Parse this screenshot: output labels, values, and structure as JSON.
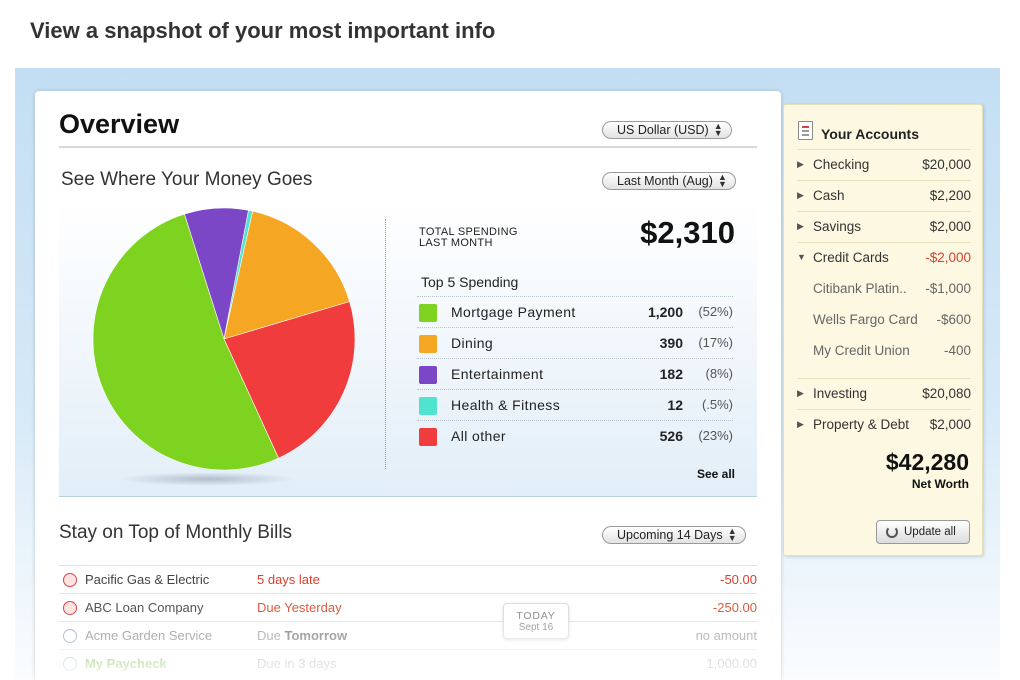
{
  "headline": "View a snapshot of your most important info",
  "overview": {
    "title": "Overview",
    "currency_select": "US Dollar (USD)"
  },
  "spending": {
    "title": "See Where Your Money Goes",
    "period_select": "Last Month (Aug)",
    "total_label_line1": "TOTAL SPENDING",
    "total_label_line2": "LAST MONTH",
    "total_amount": "$2,310",
    "top_title": "Top 5 Spending",
    "items": [
      {
        "label": "Mortgage Payment",
        "value": "1,200",
        "pct": "(52%)",
        "color": "#7ed321"
      },
      {
        "label": "Dining",
        "value": "390",
        "pct": "(17%)",
        "color": "#f5a623"
      },
      {
        "label": "Entertainment",
        "value": "182",
        "pct": "(8%)",
        "color": "#7b47c7"
      },
      {
        "label": "Health & Fitness",
        "value": "12",
        "pct": "(.5%)",
        "color": "#4fe3d0"
      },
      {
        "label": "All other",
        "value": "526",
        "pct": "(23%)",
        "color": "#f03c3c"
      }
    ],
    "see_all": "See all"
  },
  "chart_data": {
    "type": "pie",
    "categories": [
      "Mortgage Payment",
      "Dining",
      "Entertainment",
      "Health & Fitness",
      "All other"
    ],
    "values": [
      1200,
      390,
      182,
      12,
      526
    ],
    "colors": [
      "#7ed321",
      "#f5a623",
      "#7b47c7",
      "#4fe3d0",
      "#f03c3c"
    ]
  },
  "bills": {
    "title": "Stay on Top of Monthly Bills",
    "range_select": "Upcoming 14 Days",
    "rows": [
      {
        "name": "Pacific Gas & Electric",
        "status": "5 days late",
        "amount": "-50.00"
      },
      {
        "name": "ABC Loan Company",
        "status": "Due Yesterday",
        "amount": "-250.00"
      },
      {
        "name": "Acme Garden Service",
        "status_prefix": "Due",
        "status": "Tomorrow",
        "amount": "no amount"
      },
      {
        "name": "My Paycheck",
        "status": "Due in 3 days",
        "amount": "1,000.00"
      }
    ],
    "today_label": "TODAY",
    "today_date": "Sept 16"
  },
  "accounts": {
    "title": "Your Accounts",
    "rows": [
      {
        "name": "Checking",
        "value": "$20,000"
      },
      {
        "name": "Cash",
        "value": "$2,200"
      },
      {
        "name": "Savings",
        "value": "$2,000"
      },
      {
        "name": "Credit Cards",
        "value": "-$2,000"
      },
      {
        "name": "Citibank Platin..",
        "value": "-$1,000"
      },
      {
        "name": "Wells Fargo Card",
        "value": "-$600"
      },
      {
        "name": "My Credit Union",
        "value": "-400"
      },
      {
        "name": "Investing",
        "value": "$20,080"
      },
      {
        "name": "Property & Debt",
        "value": "$2,000"
      }
    ],
    "net_worth_amount": "$42,280",
    "net_worth_label": "Net Worth",
    "update_button": "Update all"
  }
}
